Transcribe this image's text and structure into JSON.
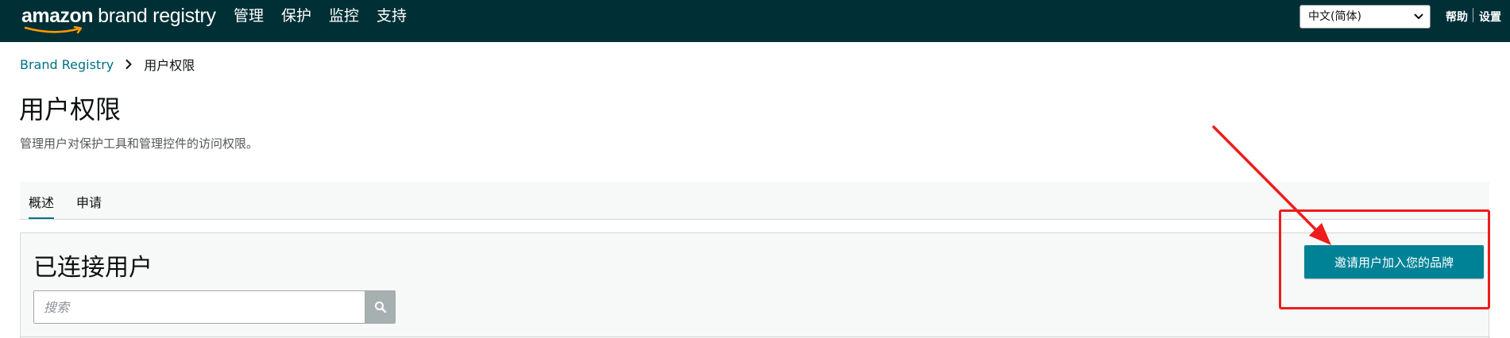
{
  "header": {
    "logo_wordmark": "amazon",
    "logo_product": "brand registry",
    "nav": [
      "管理",
      "保护",
      "监控",
      "支持"
    ],
    "language": "中文(简体)",
    "help": "帮助",
    "settings": "设置"
  },
  "breadcrumb": {
    "root": "Brand Registry",
    "current": "用户权限"
  },
  "page": {
    "title": "用户权限",
    "subtitle": "管理用户对保护工具和管理控件的访问权限。"
  },
  "tabs": [
    {
      "label": "概述",
      "active": true
    },
    {
      "label": "申请",
      "active": false
    }
  ],
  "panel": {
    "title": "已连接用户",
    "search_placeholder": "搜索",
    "invite_button": "邀请用户加入您的品牌"
  },
  "colors": {
    "topbar": "#002f36",
    "accent": "#008296",
    "link": "#007185",
    "annotation": "#ee1c1c"
  },
  "icons": {
    "search": "search-icon",
    "breadcrumb_separator": "chevron-right-icon",
    "select": "chevron-down-icon"
  }
}
